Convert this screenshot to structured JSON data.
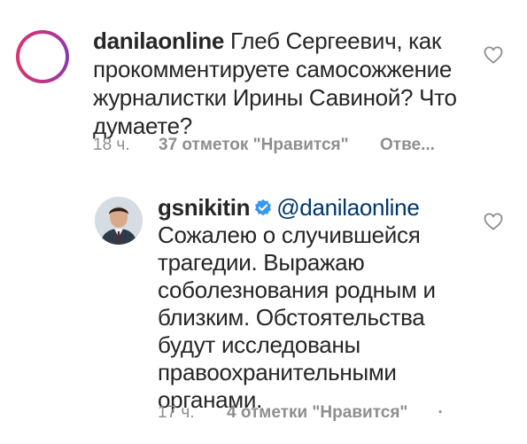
{
  "comments": [
    {
      "username": "danilaonline",
      "text": "Глеб Сергеевич, как прокомментируете самосожжение журналистки Ирины Савиной? Что думаете?",
      "time": "18 ч.",
      "likes": "37 отметок \"Нравится\"",
      "reply": "Отве..."
    },
    {
      "username": "gsnikitin",
      "verified": true,
      "mention": "@danilaonline",
      "text": "Сожалею о случившейся трагедии. Выражаю соболезнования родным и близким. Обстоятельства будут исследованы правоохранительными органами.",
      "time": "17 ч.",
      "likes": "4 отметки \"Нравится\"",
      "more": "·"
    }
  ],
  "icons": {
    "like": "heart-outline-icon",
    "verified": "verified-badge-icon"
  },
  "colors": {
    "text": "#262626",
    "meta": "#8e8e8e",
    "mention": "#00376b",
    "verified": "#3897f0"
  }
}
